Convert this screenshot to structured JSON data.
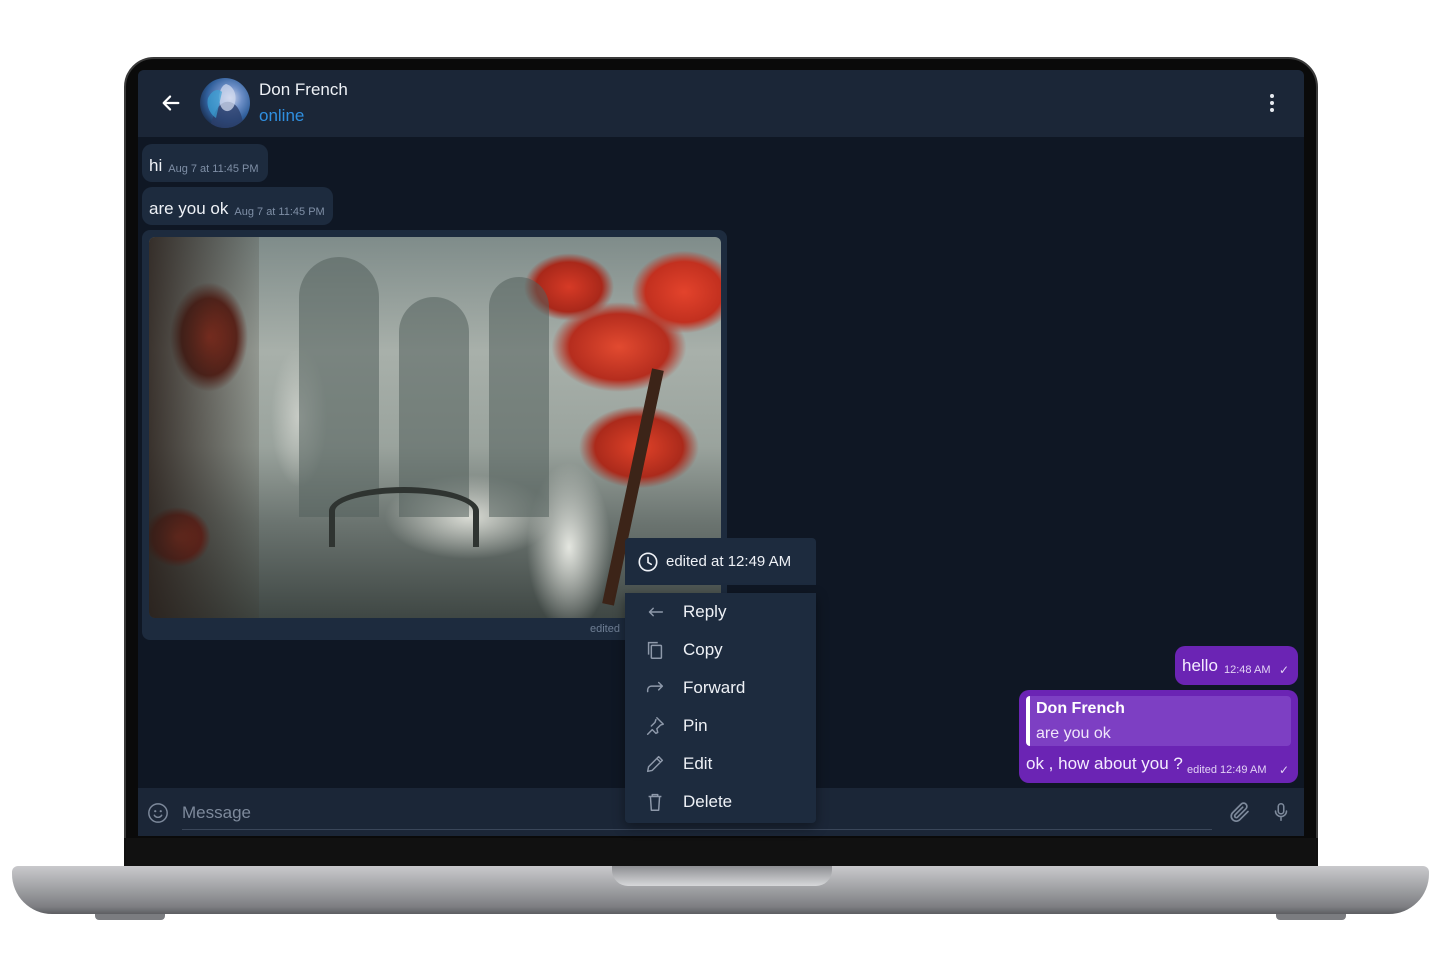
{
  "contact": {
    "name": "Don French",
    "status": "online"
  },
  "messages": {
    "incoming": [
      {
        "text": "hi",
        "time": "Aug 7 at 11:45 PM"
      },
      {
        "text": "are you ok",
        "time": "Aug 7 at 11:45 PM"
      }
    ],
    "photo": {
      "edited_label": "edited"
    },
    "outgoing": [
      {
        "text": "hello",
        "time": "12:48 AM",
        "check": "✓"
      },
      {
        "reply_to_name": "Don French",
        "reply_to_text": "are you ok",
        "text": "ok , how about you ?",
        "time": "edited 12:49 AM",
        "check": "✓"
      }
    ]
  },
  "context_menu": {
    "edited_info": "edited at 12:49 AM",
    "items": [
      {
        "label": "Reply",
        "icon": "reply-icon"
      },
      {
        "label": "Copy",
        "icon": "copy-icon"
      },
      {
        "label": "Forward",
        "icon": "forward-icon"
      },
      {
        "label": "Pin",
        "icon": "pin-icon"
      },
      {
        "label": "Edit",
        "icon": "pencil-icon"
      },
      {
        "label": "Delete",
        "icon": "trash-icon"
      }
    ]
  },
  "composer": {
    "placeholder": "Message"
  },
  "colors": {
    "header_bg": "#1b2637",
    "chat_bg": "#0f1724",
    "incoming_bubble": "#1d2b3e",
    "outgoing_bubble": "#6b24b4",
    "status_online": "#2f8fe0"
  }
}
